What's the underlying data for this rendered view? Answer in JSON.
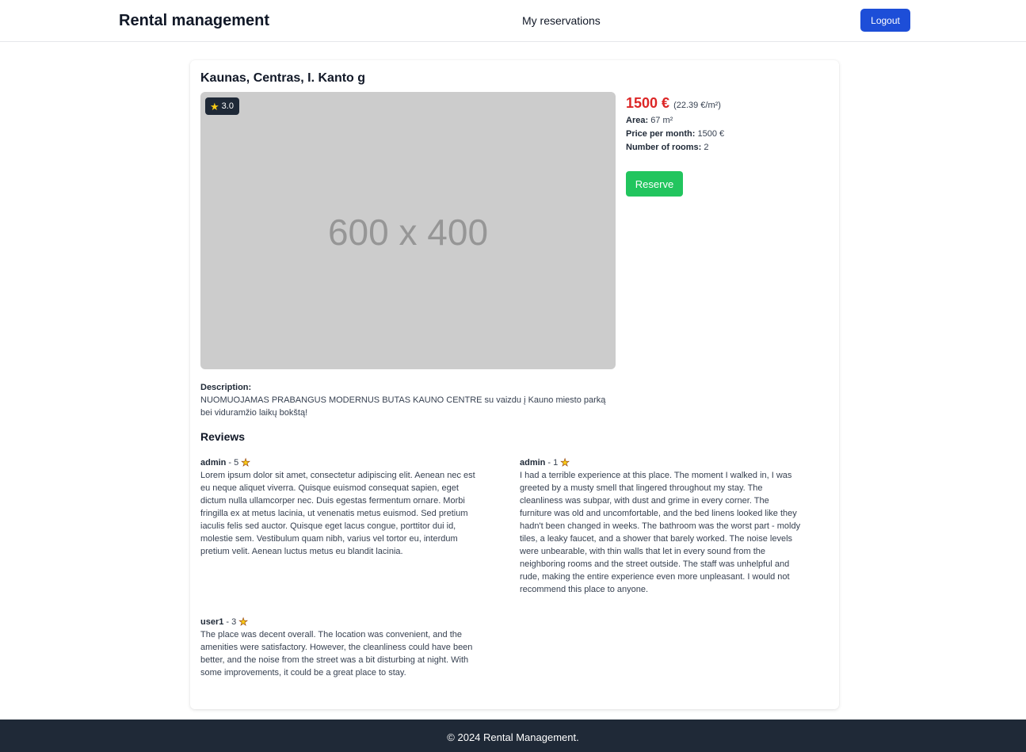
{
  "nav": {
    "brand": "Rental management",
    "reservations_link": "My reservations",
    "logout_label": "Logout"
  },
  "listing": {
    "title": "Kaunas, Centras, I. Kanto g",
    "image_placeholder": "600 x 400",
    "rating": "3.0",
    "price": "1500 €",
    "price_per_m2": "(22.39 €/m²)",
    "area_label": "Area:",
    "area_value": "67 m²",
    "price_month_label": "Price per month:",
    "price_month_value": "1500 €",
    "rooms_label": "Number of rooms:",
    "rooms_value": "2",
    "reserve_label": "Reserve",
    "description_label": "Description:",
    "description_text": "NUOMUOJAMAS PRABANGUS MODERNUS BUTAS KAUNO CENTRE su vaizdu į Kauno miesto parką bei viduramžio laikų bokštą!"
  },
  "reviews": {
    "heading": "Reviews",
    "items": [
      {
        "author": "admin",
        "score": "- 5",
        "text": "Lorem ipsum dolor sit amet, consectetur adipiscing elit. Aenean nec est eu neque aliquet viverra. Quisque euismod consequat sapien, eget dictum nulla ullamcorper nec. Duis egestas fermentum ornare. Morbi fringilla ex at metus lacinia, ut venenatis metus euismod. Sed pretium iaculis felis sed auctor. Quisque eget lacus congue, porttitor dui id, molestie sem. Vestibulum quam nibh, varius vel tortor eu, interdum pretium velit. Aenean luctus metus eu blandit lacinia."
      },
      {
        "author": "admin",
        "score": "- 1",
        "text": "I had a terrible experience at this place. The moment I walked in, I was greeted by a musty smell that lingered throughout my stay. The cleanliness was subpar, with dust and grime in every corner. The furniture was old and uncomfortable, and the bed linens looked like they hadn't been changed in weeks. The bathroom was the worst part - moldy tiles, a leaky faucet, and a shower that barely worked. The noise levels were unbearable, with thin walls that let in every sound from the neighboring rooms and the street outside. The staff was unhelpful and rude, making the entire experience even more unpleasant. I would not recommend this place to anyone."
      },
      {
        "author": "user1",
        "score": "- 3",
        "text": "The place was decent overall. The location was convenient, and the amenities were satisfactory. However, the cleanliness could have been better, and the noise from the street was a bit disturbing at night. With some improvements, it could be a great place to stay."
      }
    ]
  },
  "footer": {
    "text": "© 2024 Rental Management."
  }
}
